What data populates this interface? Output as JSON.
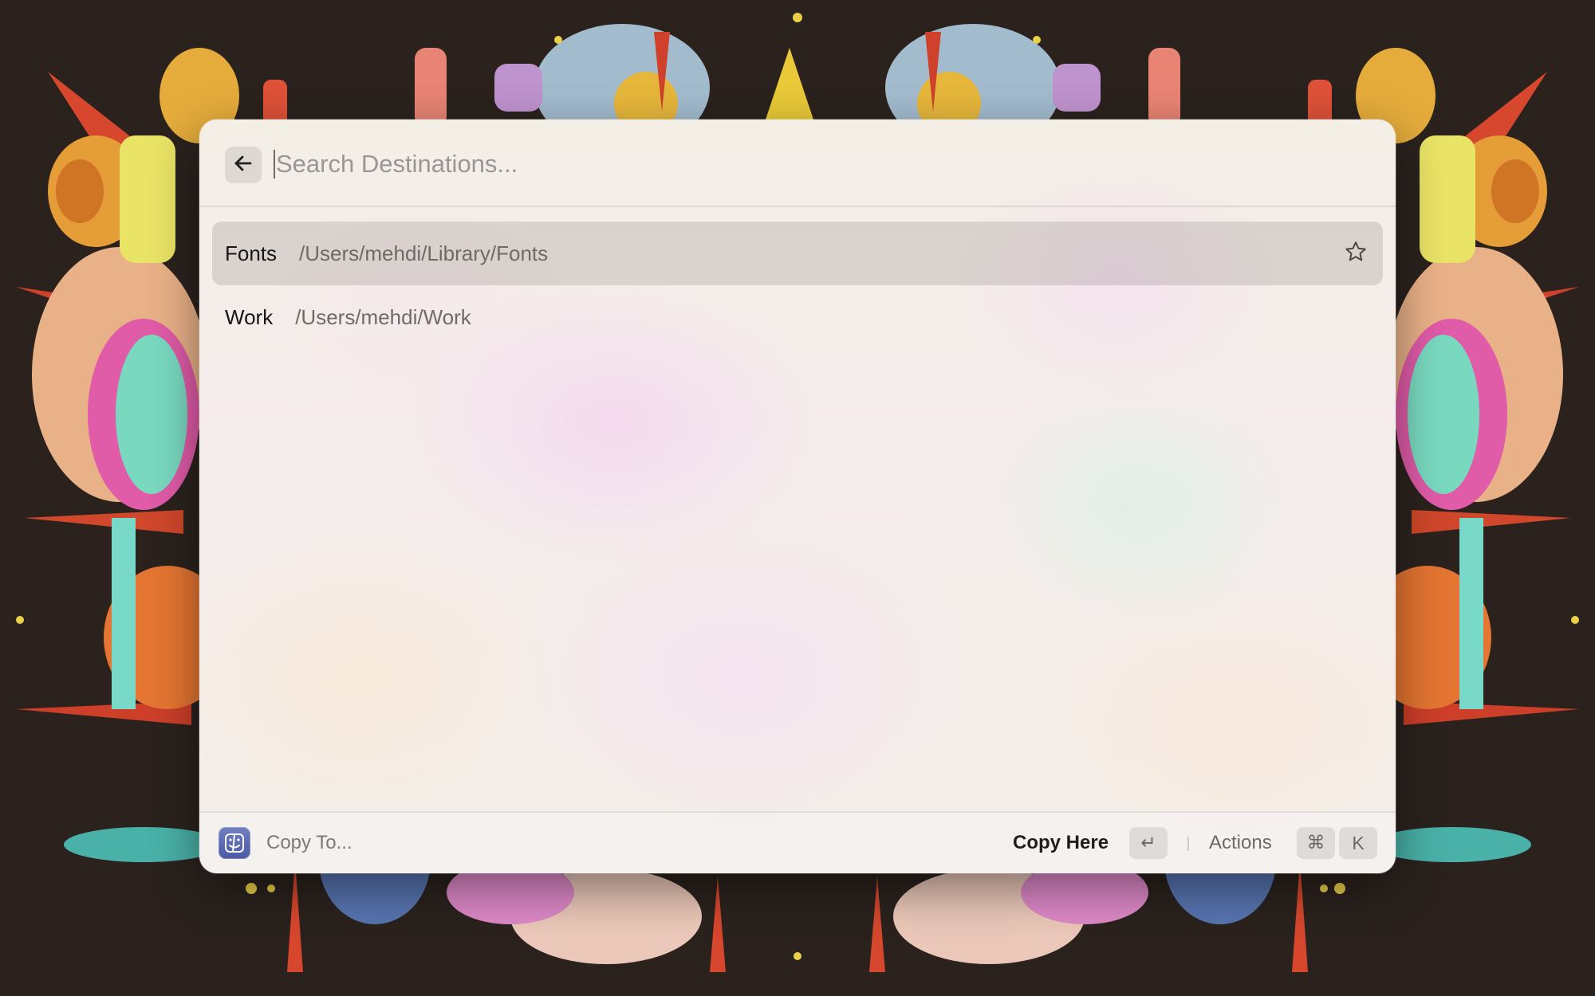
{
  "search": {
    "placeholder": "Search Destinations...",
    "value": ""
  },
  "destinations": [
    {
      "title": "Fonts",
      "path": "/Users/mehdi/Library/Fonts",
      "selected": true
    },
    {
      "title": "Work",
      "path": "/Users/mehdi/Work",
      "selected": false
    }
  ],
  "footer": {
    "title": "Copy To...",
    "primary_action": "Copy Here",
    "primary_shortcut": "↵",
    "secondary_action": "Actions",
    "secondary_shortcut_mod": "⌘",
    "secondary_shortcut_key": "K"
  },
  "icons": {
    "back": "arrow-left-icon",
    "favorite": "star-icon",
    "app": "finder-icon"
  },
  "colors": {
    "wallpaper_base": "#2b221d",
    "selected_row": "#cfcac6",
    "app_icon": "#5565ad"
  }
}
